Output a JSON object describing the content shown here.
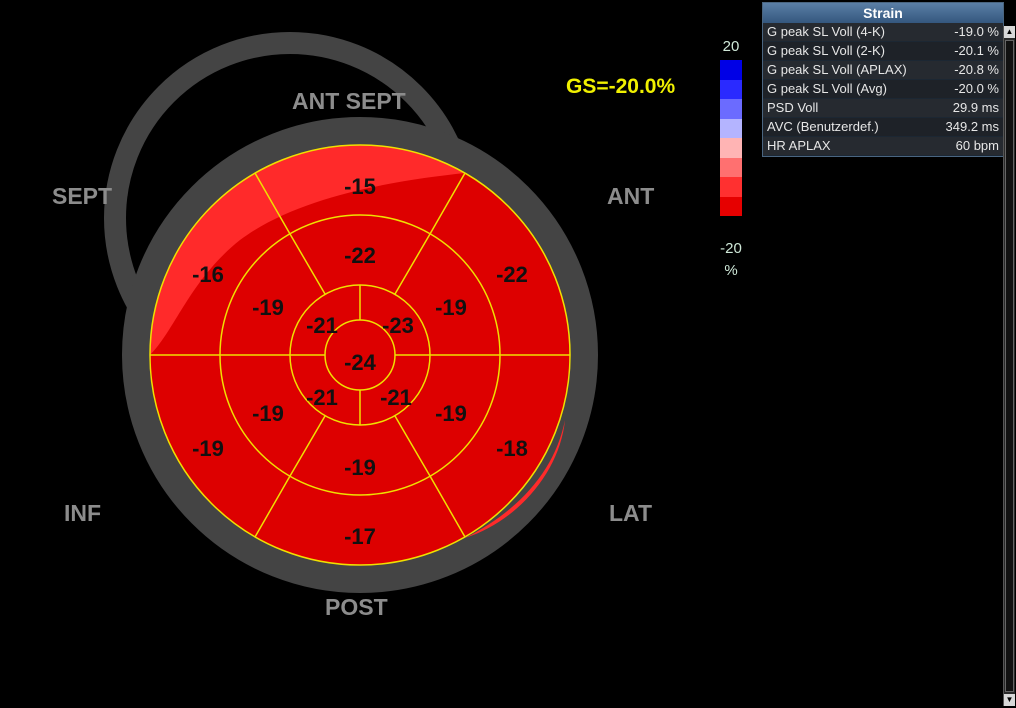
{
  "wall_labels": {
    "ant_sept": "ANT  SEPT",
    "sept": "SEPT",
    "ant": "ANT",
    "inf": "INF",
    "lat": "LAT",
    "post": "POST"
  },
  "global_strain": "GS=-20.0%",
  "color_scale": {
    "max_label": "20",
    "min_label": "-20",
    "unit": "%",
    "colors": [
      "#0000e6",
      "#2a2aff",
      "#6b6bff",
      "#b4b4ff",
      "#ffb4b4",
      "#ff7070",
      "#ff3030",
      "#e60000"
    ]
  },
  "segments": {
    "basal": [
      "-15",
      "-22",
      "-18",
      "-17",
      "-19",
      "-16"
    ],
    "mid": [
      "-22",
      "-19",
      "-19",
      "-19",
      "-19",
      "-19"
    ],
    "apical": [
      "-23",
      "-21",
      "-21",
      "-21"
    ],
    "apex": "-24"
  },
  "colors": {
    "segment_fill": "#dd0000",
    "segment_fill_light": "#ff3030",
    "segment_lines": "#f0e000",
    "ring": "#444444"
  },
  "strain_panel": {
    "title": "Strain",
    "rows": [
      {
        "label": "G peak SL Voll (4-K)",
        "value": "-19.0 %"
      },
      {
        "label": "G peak SL Voll (2-K)",
        "value": "-20.1 %"
      },
      {
        "label": "G peak SL Voll (APLAX)",
        "value": "-20.8 %"
      },
      {
        "label": "G peak SL Voll (Avg)",
        "value": "-20.0 %"
      },
      {
        "label": "PSD Voll",
        "value": "29.9 ms"
      },
      {
        "label": "AVC (Benutzerdef.)",
        "value": "349.2 ms"
      },
      {
        "label": "HR APLAX",
        "value": "60 bpm"
      }
    ]
  }
}
